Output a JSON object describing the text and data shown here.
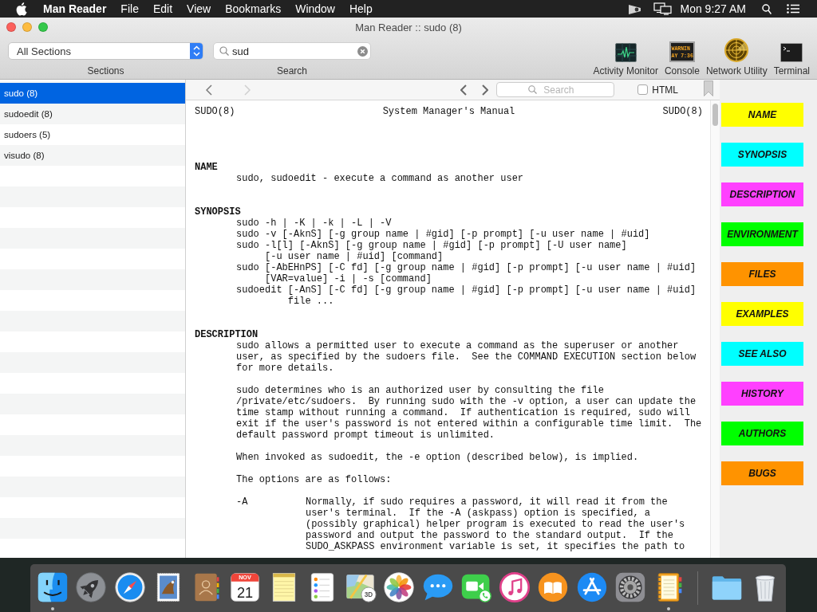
{
  "menu_bar": {
    "app_name": "Man Reader",
    "menus": [
      "File",
      "Edit",
      "View",
      "Bookmarks",
      "Window",
      "Help"
    ],
    "clock": "Mon 9:27 AM"
  },
  "window": {
    "title": "Man Reader :: sudo (8)"
  },
  "toolbar": {
    "sections_popup": {
      "value": "All Sections",
      "label": "Sections"
    },
    "search": {
      "value": "sud",
      "label": "Search"
    },
    "tools": [
      {
        "kind": "waveform",
        "label": "Activity Monitor"
      },
      {
        "kind": "console",
        "label": "Console",
        "screen_lines": [
          "WARNIN",
          "AY 7:36"
        ]
      },
      {
        "kind": "radar",
        "label": "Network Utility"
      },
      {
        "kind": "terminal",
        "label": "Terminal"
      }
    ]
  },
  "page_list": {
    "items": [
      {
        "label": "sudo (8)",
        "selected": true
      },
      {
        "label": "sudoedit (8)",
        "selected": false
      },
      {
        "label": "sudoers (5)",
        "selected": false
      },
      {
        "label": "visudo (8)",
        "selected": false
      }
    ]
  },
  "viewer": {
    "back": {
      "disabled": false
    },
    "forward": {
      "disabled": true
    },
    "find": {
      "placeholder": "Search"
    },
    "html_checkbox": {
      "label": "HTML",
      "checked": false
    },
    "manual": {
      "header": {
        "left": "SUDO(8)",
        "center": "System Manager's Manual",
        "right": "SUDO(8)"
      },
      "sections": [
        {
          "heading": "NAME",
          "blocks": [
            {
              "kind": "paragraph",
              "text": "sudo, sudoedit - execute a command as another user"
            }
          ]
        },
        {
          "heading": "SYNOPSIS",
          "blocks": [
            {
              "kind": "command",
              "text": "sudo -h | -K | -k | -L | -V"
            },
            {
              "kind": "command",
              "text": "sudo -v [-AknS] [-g group name | #gid] [-p prompt] [-u user name | #uid]"
            },
            {
              "kind": "command",
              "text": "sudo -l[l] [-AknS] [-g group name | #gid] [-p prompt] [-U user name]\n[-u user name | #uid] [command]"
            },
            {
              "kind": "command",
              "text": "sudo [-AbEHnPS] [-C fd] [-g group name | #gid] [-p prompt] [-u user name | #uid]\n[VAR=value] -i | -s [command]"
            },
            {
              "kind": "command",
              "text": "sudoedit [-AnS] [-C fd] [-g group name | #gid] [-p prompt] [-u user name | #uid]\nfile ..."
            }
          ]
        },
        {
          "heading": "DESCRIPTION",
          "blocks": [
            {
              "kind": "paragraph",
              "text": "sudo allows a permitted user to execute a command as the superuser or another\nuser, as specified by the sudoers file.  See the COMMAND EXECUTION section below\nfor more details."
            },
            {
              "kind": "paragraph",
              "text": "sudo determines who is an authorized user by consulting the file\n/private/etc/sudoers.  By running sudo with the -v option, a user can update the\ntime stamp without running a command.  If authentication is required, sudo will\nexit if the user's password is not entered within a configurable time limit.  The\ndefault password prompt timeout is unlimited."
            },
            {
              "kind": "paragraph",
              "text": "When invoked as sudoedit, the -e option (described below), is implied."
            },
            {
              "kind": "paragraph",
              "text": "The options are as follows:"
            },
            {
              "kind": "option",
              "flag": "-A",
              "text": "Normally, if sudo requires a password, it will read it from the\nuser's terminal.  If the -A (askpass) option is specified, a\n(possibly graphical) helper program is executed to read the user's\npassword and output the password to the standard output.  If the\nSUDO_ASKPASS environment variable is set, it specifies the path to"
            }
          ]
        }
      ]
    }
  },
  "section_tags": [
    {
      "label": "NAME",
      "color": "#ffff00"
    },
    {
      "label": "SYNOPSIS",
      "color": "#00ffff"
    },
    {
      "label": "DESCRIPTION",
      "color": "#ff40ff"
    },
    {
      "label": "ENVIRONMENT",
      "color": "#00ff00"
    },
    {
      "label": "FILES",
      "color": "#ff9300"
    },
    {
      "label": "EXAMPLES",
      "color": "#ffff00"
    },
    {
      "label": "SEE ALSO",
      "color": "#00ffff"
    },
    {
      "label": "HISTORY",
      "color": "#ff40ff"
    },
    {
      "label": "AUTHORS",
      "color": "#00ff00"
    },
    {
      "label": "BUGS",
      "color": "#ff9300"
    }
  ],
  "dock": {
    "apps": [
      {
        "kind": "finder",
        "running": true
      },
      {
        "kind": "rocket",
        "running": false
      },
      {
        "kind": "compass",
        "running": false
      },
      {
        "kind": "stamp",
        "running": false
      },
      {
        "kind": "address_book",
        "running": false
      },
      {
        "kind": "calendar",
        "running": false,
        "month": "NOV",
        "day": "21"
      },
      {
        "kind": "notepad",
        "running": false
      },
      {
        "kind": "checklist",
        "running": false
      },
      {
        "kind": "map",
        "running": false,
        "badge": "3D"
      },
      {
        "kind": "flower",
        "running": false
      },
      {
        "kind": "speech_bubble",
        "running": false
      },
      {
        "kind": "video_camera",
        "running": false
      },
      {
        "kind": "music_note",
        "running": false
      },
      {
        "kind": "open_book",
        "running": false
      },
      {
        "kind": "letter_a",
        "running": false
      },
      {
        "kind": "gear",
        "running": false
      },
      {
        "kind": "notebook",
        "running": true
      }
    ],
    "stack": [
      {
        "kind": "folder",
        "running": false
      },
      {
        "kind": "trash",
        "running": false
      }
    ]
  }
}
